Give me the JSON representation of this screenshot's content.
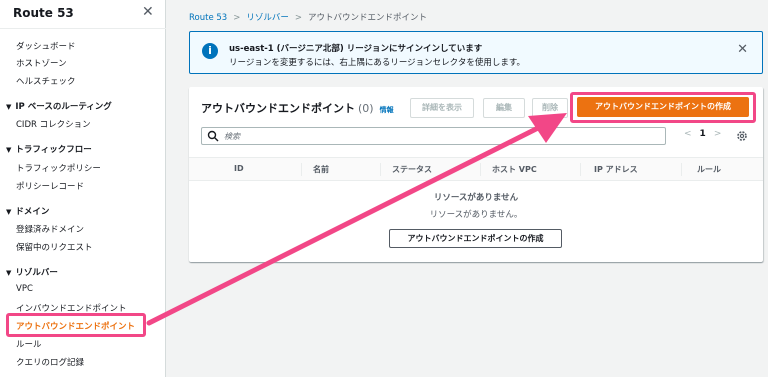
{
  "sidebar": {
    "title": "Route 53",
    "items_top": [
      "ダッシュボード",
      "ホストゾーン",
      "ヘルスチェック"
    ],
    "groups": [
      {
        "label": "IP ベースのルーティング",
        "items": [
          "CIDR コレクション"
        ]
      },
      {
        "label": "トラフィックフロー",
        "items": [
          "トラフィックポリシー",
          "ポリシーレコード"
        ]
      },
      {
        "label": "ドメイン",
        "items": [
          "登録済みドメイン",
          "保留中のリクエスト"
        ]
      },
      {
        "label": "リゾルバー",
        "items": [
          "VPC",
          "インバウンドエンドポイント",
          "アウトバウンドエンドポイント",
          "ルール",
          "クエリのログ記録"
        ]
      }
    ]
  },
  "breadcrumb": {
    "root": "Route 53",
    "parent": "リゾルバー",
    "current": "アウトバウンドエンドポイント"
  },
  "banner": {
    "title": "us-east-1 (バージニア北部) リージョンにサインインしています",
    "text": "リージョンを変更するには、右上隅にあるリージョンセレクタを使用します。"
  },
  "panel": {
    "title": "アウトバウンドエンドポイント",
    "count": "(0)",
    "info": "情報",
    "buttons": {
      "details": "詳細を表示",
      "edit": "編集",
      "delete": "削除",
      "create": "アウトバウンドエンドポイントの作成"
    },
    "search_placeholder": "検索",
    "page": "1",
    "columns": [
      "ID",
      "名前",
      "ステータス",
      "ホスト VPC",
      "IP アドレス",
      "ルール"
    ],
    "empty_title": "リソースがありません",
    "empty_text": "リソースがありません。",
    "empty_button": "アウトバウンドエンドポイントの作成"
  },
  "colors": {
    "accent": "#ec7211",
    "link": "#0073bb",
    "annotation": "#f24787"
  }
}
